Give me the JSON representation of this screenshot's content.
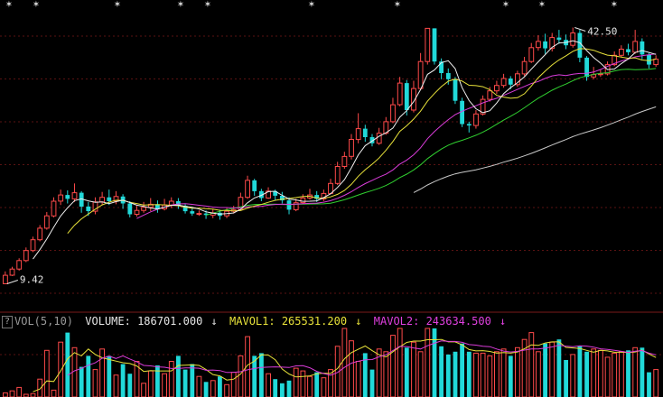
{
  "colors": {
    "background": "#000000",
    "grid": "#5a1212",
    "up": "#ff4a4a",
    "down": "#21d9d9",
    "ma5": "#f0f0f0",
    "ma10": "#e8e23a",
    "ma20": "#d93cd9",
    "ma30": "#30d030",
    "ma60": "#c8c8c8",
    "label": "#e6e6e6"
  },
  "annotations": {
    "high_label": "42.50",
    "low_label": "9.42"
  },
  "volume_legend": {
    "help": "?",
    "name": "VOL(5,10)",
    "volume_label": "VOLUME: 186701.000",
    "mavol1_label": "MAVOL1: 265531.200",
    "mavol2_label": "MAVOL2: 243634.500",
    "arrow": "↓"
  },
  "chart_data": [
    {
      "type": "candlestick",
      "title": "",
      "ylim": [
        7,
        45
      ],
      "grid": true,
      "high": 42.5,
      "low": 9.42,
      "candles": [
        [
          9.4,
          10.5,
          11.0,
          9.4
        ],
        [
          10.5,
          11.3,
          11.6,
          10.4
        ],
        [
          11.3,
          12.4,
          12.7,
          11.1
        ],
        [
          12.4,
          13.7,
          14.1,
          12.2
        ],
        [
          13.7,
          15.1,
          15.5,
          13.5
        ],
        [
          15.1,
          16.6,
          17.0,
          14.9
        ],
        [
          16.6,
          18.2,
          18.7,
          16.4
        ],
        [
          18.2,
          20.1,
          20.6,
          18.0
        ],
        [
          20.1,
          20.9,
          21.6,
          19.6
        ],
        [
          20.9,
          20.4,
          21.5,
          19.8
        ],
        [
          20.4,
          21.2,
          22.4,
          20.0
        ],
        [
          21.2,
          19.4,
          21.4,
          18.6
        ],
        [
          19.4,
          18.8,
          20.0,
          18.2
        ],
        [
          18.8,
          20.0,
          20.6,
          18.4
        ],
        [
          20.0,
          20.6,
          21.3,
          19.6
        ],
        [
          20.6,
          20.1,
          21.6,
          19.6
        ],
        [
          20.1,
          20.7,
          21.4,
          19.7
        ],
        [
          20.7,
          19.8,
          21.0,
          19.1
        ],
        [
          19.8,
          18.4,
          20.1,
          18.0
        ],
        [
          18.4,
          18.9,
          19.5,
          18.1
        ],
        [
          18.9,
          19.3,
          20.0,
          18.6
        ],
        [
          19.3,
          19.7,
          20.5,
          18.8
        ],
        [
          19.7,
          19.1,
          20.2,
          18.6
        ],
        [
          19.1,
          19.6,
          20.4,
          18.9
        ],
        [
          19.6,
          20.1,
          20.6,
          19.2
        ],
        [
          20.1,
          19.5,
          20.5,
          19.1
        ],
        [
          19.5,
          18.8,
          19.7,
          18.5
        ],
        [
          18.8,
          18.5,
          19.2,
          18.2
        ],
        [
          18.5,
          18.5,
          18.9,
          18.2
        ],
        [
          18.5,
          18.3,
          18.9,
          17.8
        ],
        [
          18.3,
          18.6,
          19.1,
          17.9
        ],
        [
          18.6,
          18.2,
          19.0,
          17.7
        ],
        [
          18.2,
          18.8,
          19.2,
          17.9
        ],
        [
          18.8,
          19.0,
          19.5,
          18.5
        ],
        [
          19.0,
          20.6,
          21.2,
          18.9
        ],
        [
          20.6,
          22.8,
          23.4,
          20.4
        ],
        [
          22.8,
          21.4,
          23.0,
          20.8
        ],
        [
          21.4,
          20.5,
          21.7,
          20.1
        ],
        [
          20.5,
          21.4,
          21.9,
          20.4
        ],
        [
          21.4,
          20.8,
          21.6,
          20.2
        ],
        [
          20.8,
          20.2,
          21.3,
          19.8
        ],
        [
          20.2,
          19.0,
          20.6,
          18.4
        ],
        [
          19.0,
          19.9,
          20.4,
          18.8
        ],
        [
          19.9,
          20.5,
          21.0,
          19.7
        ],
        [
          20.5,
          20.9,
          21.7,
          20.3
        ],
        [
          20.9,
          20.4,
          21.4,
          20.0
        ],
        [
          20.4,
          21.1,
          21.6,
          20.1
        ],
        [
          21.1,
          22.4,
          23.0,
          21.0
        ],
        [
          22.4,
          24.6,
          25.2,
          22.2
        ],
        [
          24.6,
          25.9,
          26.5,
          24.3
        ],
        [
          25.9,
          28.1,
          28.8,
          25.5
        ],
        [
          28.1,
          29.5,
          31.5,
          27.6
        ],
        [
          29.5,
          28.4,
          30.0,
          27.8
        ],
        [
          28.4,
          27.6,
          28.8,
          27.2
        ],
        [
          27.6,
          28.9,
          29.6,
          27.4
        ],
        [
          28.9,
          30.4,
          31.0,
          28.7
        ],
        [
          30.4,
          32.6,
          33.5,
          30.2
        ],
        [
          32.6,
          35.4,
          36.2,
          32.4
        ],
        [
          35.4,
          31.9,
          35.8,
          31.2
        ],
        [
          31.9,
          34.7,
          35.7,
          31.6
        ],
        [
          34.7,
          38.2,
          39.3,
          34.5
        ],
        [
          38.2,
          42.5,
          42.5,
          37.8
        ],
        [
          42.5,
          38.2,
          42.5,
          37.8
        ],
        [
          38.2,
          36.7,
          38.6,
          35.9
        ],
        [
          36.7,
          35.9,
          37.3,
          35.2
        ],
        [
          35.9,
          33.1,
          36.2,
          32.7
        ],
        [
          33.1,
          30.1,
          33.5,
          29.7
        ],
        [
          30.1,
          29.9,
          30.4,
          29.0
        ],
        [
          29.9,
          31.4,
          31.9,
          29.5
        ],
        [
          31.4,
          33.3,
          33.8,
          31.2
        ],
        [
          33.3,
          34.4,
          34.9,
          33.0
        ],
        [
          34.4,
          35.1,
          35.7,
          34.0
        ],
        [
          35.1,
          36.0,
          36.6,
          34.8
        ],
        [
          36.0,
          35.2,
          36.3,
          34.6
        ],
        [
          35.2,
          36.6,
          37.0,
          34.9
        ],
        [
          36.6,
          38.2,
          38.8,
          36.3
        ],
        [
          38.2,
          40.0,
          40.6,
          38.0
        ],
        [
          40.0,
          40.8,
          41.6,
          39.6
        ],
        [
          40.8,
          39.9,
          41.8,
          39.2
        ],
        [
          39.9,
          41.3,
          41.9,
          39.5
        ],
        [
          41.3,
          41.0,
          42.3,
          40.5
        ],
        [
          41.0,
          40.3,
          41.7,
          39.8
        ],
        [
          40.3,
          41.9,
          42.6,
          40.0
        ],
        [
          41.9,
          38.7,
          42.3,
          38.1
        ],
        [
          38.7,
          36.2,
          38.9,
          35.7
        ],
        [
          36.2,
          36.5,
          37.5,
          35.9
        ],
        [
          36.5,
          36.6,
          37.1,
          36.2
        ],
        [
          36.6,
          37.8,
          38.2,
          36.4
        ],
        [
          37.8,
          39.0,
          39.5,
          37.6
        ],
        [
          39.0,
          39.8,
          40.3,
          38.7
        ],
        [
          39.8,
          39.4,
          40.5,
          39.0
        ],
        [
          39.4,
          40.8,
          42.3,
          39.2
        ],
        [
          40.8,
          39.1,
          41.2,
          38.5
        ],
        [
          39.1,
          37.8,
          39.3,
          37.3
        ],
        [
          37.8,
          38.5,
          39.0,
          37.5
        ]
      ]
    },
    {
      "type": "bar",
      "title": "",
      "series_name": "VOLUME",
      "values": [
        6,
        9,
        14,
        4,
        5,
        26,
        68,
        10,
        80,
        94,
        72,
        44,
        60,
        40,
        70,
        60,
        32,
        48,
        34,
        52,
        20,
        38,
        46,
        34,
        52,
        60,
        40,
        48,
        30,
        22,
        24,
        30,
        18,
        36,
        60,
        88,
        60,
        64,
        34,
        26,
        20,
        24,
        42,
        38,
        30,
        36,
        28,
        40,
        74,
        100,
        82,
        52,
        64,
        40,
        70,
        66,
        90,
        100,
        72,
        80,
        66,
        100,
        100,
        74,
        62,
        66,
        78,
        66,
        64,
        64,
        60,
        66,
        70,
        60,
        72,
        84,
        94,
        66,
        78,
        80,
        84,
        54,
        62,
        74,
        66,
        70,
        68,
        58,
        64,
        66,
        68,
        72,
        72,
        36,
        40
      ],
      "mavol1_last": 265531.2,
      "mavol2_last": 243634.5
    }
  ]
}
